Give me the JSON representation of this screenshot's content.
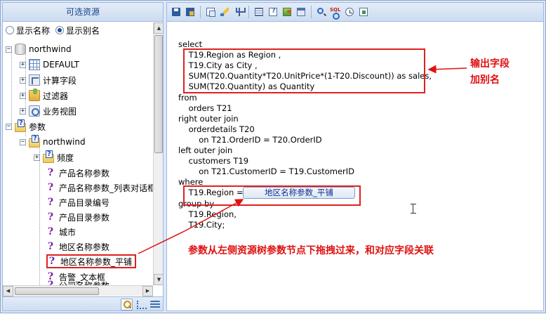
{
  "left_panel": {
    "title": "可选资源",
    "options": [
      {
        "label": "显示名称",
        "checked": false
      },
      {
        "label": "显示别名",
        "checked": true
      }
    ],
    "tree": {
      "root": "northwind",
      "root_children": [
        "DEFAULT",
        "计算字段",
        "过滤器",
        "业务视图"
      ],
      "params_label": "参数",
      "params_child": "northwind",
      "folder": "频度",
      "params": [
        "产品名称参数",
        "产品名称参数_列表对话框",
        "产品目录编号",
        "产品目录参数",
        "城市",
        "地区名称参数",
        "地区名称参数_平铺",
        "告警_文本框",
        "公司名称参数"
      ]
    }
  },
  "sql": {
    "lines": [
      "select",
      "    T19.Region as Region ,",
      "    T19.City as City ,",
      "    SUM(T20.Quantity*T20.UnitPrice*(1-T20.Discount)) as sales,",
      "    SUM(T20.Quantity) as Quantity",
      "from",
      "    orders T21",
      "right outer join",
      "    orderdetails T20",
      "        on T21.OrderID = T20.OrderID",
      "left outer join",
      "    customers T19",
      "        on T21.CustomerID = T19.CustomerID",
      "where",
      "    T19.Region = ",
      "group by",
      "    T19.Region,",
      "    T19.City;"
    ],
    "where_param": "地区名称参数_平铺"
  },
  "annotations": {
    "alias_note_line1": "输出字段",
    "alias_note_line2": "加别名",
    "drag_note": "参数从左侧资源树参数节点下拖拽过来，和对应字段关联"
  },
  "colors": {
    "annotation": "#e01010",
    "param": "#0c2f8f",
    "header": "#15428b"
  }
}
